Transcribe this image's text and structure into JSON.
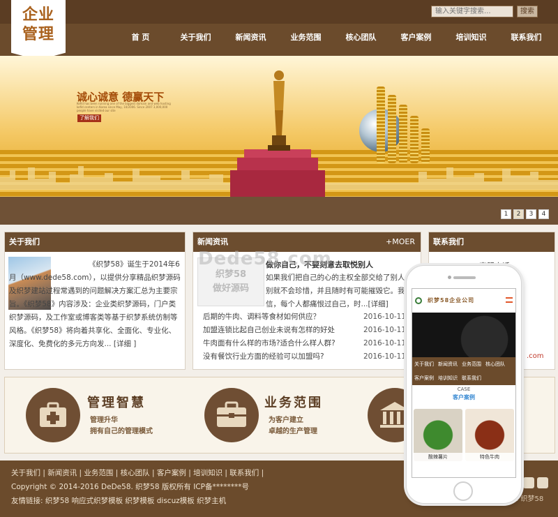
{
  "logo": {
    "line1": "企业",
    "line2": "管理"
  },
  "search": {
    "placeholder": "输入关键字搜索...",
    "button": "搜索"
  },
  "nav": [
    "首 页",
    "关于我们",
    "新闻资讯",
    "业务范围",
    "核心团队",
    "客户案例",
    "培训知识",
    "联系我们"
  ],
  "banner": {
    "title": "诚心诚意 德赢天下",
    "small_text": "Kefid has been running one of the biggest domain and web hosting kefid centers in Korea since May, 10/2006. Since 2007 3,000,000 people have visited our site",
    "button": "了解我们",
    "pages": [
      "1",
      "2",
      "3",
      "4"
    ],
    "active_page": 2
  },
  "about": {
    "title": "关于我们",
    "text": "《织梦58》诞生于2014年6月（www.dede58.com），以提供分享精品织梦源码及织梦建站过程常遇到的问题解决方案汇总为主要宗旨。《织梦58》内容涉及：企业类织梦源码，门户类织梦源码，及工作室或博客类等基于织梦系统仿制等风格。《织梦58》将向着共享化、全面化、专业化、深度化、免费化的多元方向发... [详细 ]"
  },
  "news": {
    "title": "新闻资讯",
    "more": "+MOER",
    "thumb_line1": "织梦58",
    "thumb_line2": "做好源码",
    "featured_title": "做你自己，不要刻意去取悦别人",
    "featured_text": "如果我们把自己的心的主权全部交给了别人，别就不会珍惜，并且随时有可能摧毁它。我相信，每个人都痛恨过自己，时...[详细]",
    "items": [
      {
        "title": "后期的牛肉、调料等食材如何供应？",
        "date": "2016-10-11"
      },
      {
        "title": "加盟连锁比起自己创业未说有怎样的好处",
        "date": "2016-10-11"
      },
      {
        "title": "牛肉面有什么样的市场?适合什么样人群?",
        "date": "2016-10-11"
      },
      {
        "title": "没有餐饮行业方面的经验可以加盟吗?",
        "date": "2016-10-11"
      }
    ]
  },
  "contact": {
    "title": "联系我们",
    "hotline": "客服电话",
    "site": ".com"
  },
  "watermark": "Dede58.com",
  "services": [
    {
      "title": "管理智慧",
      "desc1": "管理升华",
      "desc2": "拥有自己的管理模式"
    },
    {
      "title": "业务范围",
      "desc1": "为客户建立",
      "desc2": "卓越的生产管理"
    }
  ],
  "footer": {
    "links": "关于我们 | 新闻资讯 | 业务范围 | 核心团队 | 客户案例 | 培训知识 | 联系我们 |",
    "copyright": "Copyright © 2014-2016 DeDe58. 织梦58 版权所有 ICP备********号",
    "friend_links": "友情链接: 织梦58 响应式织梦模板 织梦模板 discuz模板 织梦主机",
    "right_text": "话: 织梦58"
  },
  "phone": {
    "header": "织梦58企业公司",
    "nav": [
      "关于我们",
      "新闻资讯",
      "业务范围",
      "核心团队",
      "客户案例",
      "培训知识",
      "联系我们"
    ],
    "case_en": "CASE",
    "case_cn": "客户案例",
    "food1": "酸辣薯片",
    "food2": "特色牛肉"
  },
  "colors": {
    "brand_brown": "#6b4b2c",
    "logo_orange": "#a9611d",
    "accent_red": "#a53018"
  }
}
